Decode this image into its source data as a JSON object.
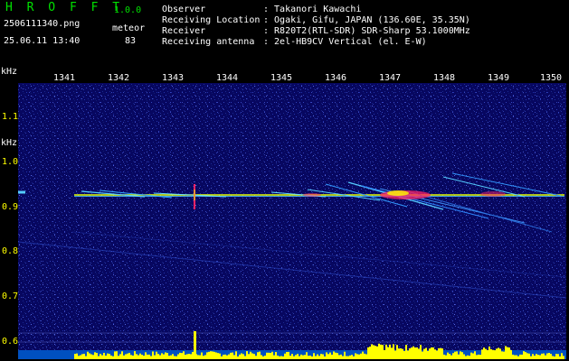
{
  "header": {
    "logo_text": "H R O F F T",
    "version": "1.0.0",
    "filename": "2506111340.png",
    "meteor_label": "meteor",
    "datetime": "25.06.11 13:40",
    "meteor_count": "83",
    "info_labels": {
      "observer": "Observer",
      "location": "Receiving Location",
      "receiver": "Receiver",
      "antenna": "Receiving antenna"
    },
    "info_values": {
      "observer": ": Takanori Kawachi",
      "location": ": Ogaki, Gifu, JAPAN (136.60E, 35.35N)",
      "receiver": ": R820T2(RTL-SDR) SDR-Sharp 53.1000MHz",
      "antenna": ": 2el-HB9CV Vertical (el. E-W)"
    }
  },
  "axes": {
    "unit_top": "kHz",
    "unit_left": "kHz",
    "time_ticks": [
      "1341",
      "1342",
      "1343",
      "1344",
      "1345",
      "1346",
      "1347",
      "1348",
      "1349",
      "1350"
    ],
    "freq_ticks": [
      "1.1",
      "1.0",
      "0.9",
      "0.8",
      "0.7",
      "0.6"
    ]
  },
  "colors": {
    "background": "#000000",
    "plot_background": "#070760",
    "carrier": "#e6ff00",
    "echo": "#55ccff",
    "hot_echo": "#ff2266",
    "signal_bars": "#ffff00",
    "noise_band": "#00aaff",
    "logo": "#00e000",
    "tick_labels": "#ffff00"
  }
}
